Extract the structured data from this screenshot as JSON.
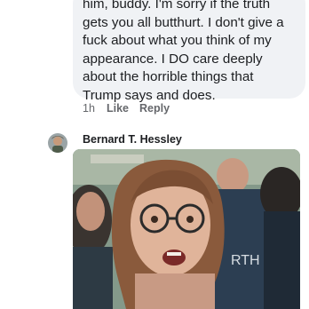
{
  "comment": {
    "lines": [
      "him, buddy. I'm sorry if the truth",
      "gets you all butthurt. I don't give a",
      "fuck about what you think of my",
      "appearance. I DO care deeply",
      "about the horrible things that",
      "Trump says and does."
    ],
    "timestamp": "1h",
    "like_label": "Like",
    "reply_label": "Reply"
  },
  "reply_comment": {
    "author": "Bernard T. Hessley",
    "avatar_icon": "user-avatar",
    "image_icon": "meme-photo"
  },
  "colors": {
    "bubble_bg": "#f0f2f5",
    "text": "#1c1e21",
    "meta_text": "#65676b"
  }
}
